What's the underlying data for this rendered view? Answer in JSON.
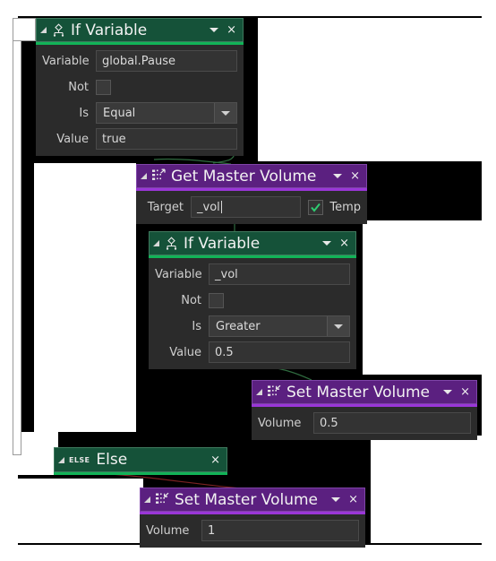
{
  "app": {
    "canvas_background": "#ffffff",
    "flow_shape_color": "#000000",
    "accent_green": "#11b357",
    "accent_purple": "#9a36d8",
    "header_green": "#155239",
    "header_purple": "#5b2080",
    "node_body": "#2b2b2b",
    "wire_green": "#2f6b3f",
    "wire_red": "#7a2222"
  },
  "nodes": [
    {
      "id": "if-variable-1",
      "title": "If Variable",
      "icon": "if-branch-icon",
      "type": "condition",
      "close_label": "×",
      "rows": {
        "variable_label": "Variable",
        "variable_value": "global.Pause",
        "not_label": "Not",
        "not_checked": false,
        "is_label": "Is",
        "is_value": "Equal",
        "value_label": "Value",
        "value_value": "true"
      }
    },
    {
      "id": "get-master-volume",
      "title": "Get Master Volume",
      "icon": "get-node-icon",
      "type": "action",
      "close_label": "×",
      "rows": {
        "target_label": "Target",
        "target_value": "_vol",
        "temp_label": "Temp",
        "temp_checked": true
      }
    },
    {
      "id": "if-variable-2",
      "title": "If Variable",
      "icon": "if-branch-icon",
      "type": "condition",
      "close_label": "×",
      "rows": {
        "variable_label": "Variable",
        "variable_value": "_vol",
        "not_label": "Not",
        "not_checked": false,
        "is_label": "Is",
        "is_value": "Greater",
        "value_label": "Value",
        "value_value": "0.5"
      }
    },
    {
      "id": "set-master-volume-1",
      "title": "Set Master Volume",
      "icon": "set-node-icon",
      "type": "action",
      "close_label": "×",
      "rows": {
        "volume_label": "Volume",
        "volume_value": "0.5"
      }
    },
    {
      "id": "else",
      "title": "Else",
      "tag": "ELSE",
      "icon": "else-icon",
      "type": "branch",
      "close_label": "×"
    },
    {
      "id": "set-master-volume-2",
      "title": "Set Master Volume",
      "icon": "set-node-icon",
      "type": "action",
      "close_label": "×",
      "rows": {
        "volume_label": "Volume",
        "volume_value": "1"
      }
    }
  ]
}
